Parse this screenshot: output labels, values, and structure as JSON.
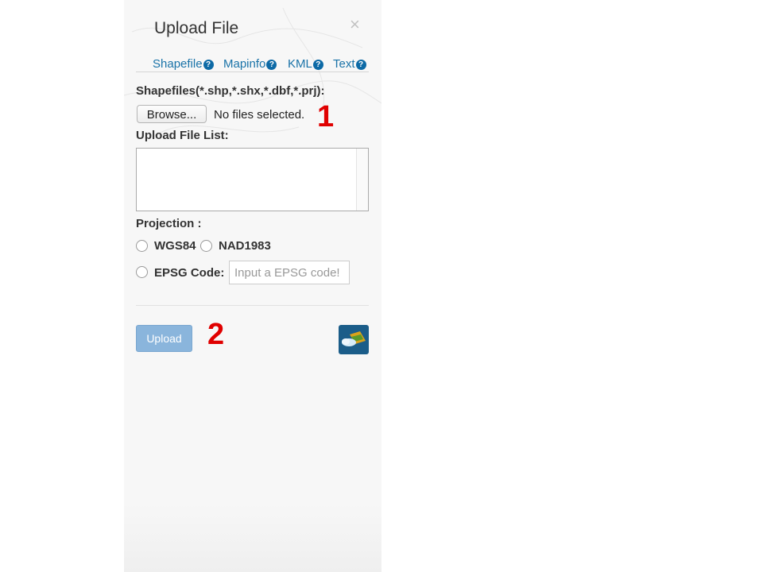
{
  "dialog": {
    "title": "Upload File",
    "close_symbol": "×"
  },
  "tabs": [
    {
      "label": "Shapefile",
      "icon": "help-icon"
    },
    {
      "label": "Mapinfo",
      "icon": "help-icon"
    },
    {
      "label": "KML",
      "icon": "help-icon"
    },
    {
      "label": "Text",
      "icon": "help-icon"
    }
  ],
  "help_glyph": "?",
  "shapefile": {
    "label": "Shapefiles(*.shp,*.shx,*.dbf,*.prj):",
    "browse_label": "Browse...",
    "file_status": "No files selected."
  },
  "file_list": {
    "label": "Upload File List:"
  },
  "projection": {
    "label": "Projection :",
    "options": [
      {
        "label": "WGS84",
        "selected": false
      },
      {
        "label": "NAD1983",
        "selected": false
      },
      {
        "label": "EPSG Code:",
        "selected": false
      }
    ],
    "epsg_placeholder": "Input a EPSG code!",
    "epsg_value": ""
  },
  "upload_label": "Upload",
  "annotations": [
    "1",
    "2"
  ],
  "colors": {
    "accent": "#1a73a8",
    "upload_button": "#8ab5dc",
    "annotation": "#e00000",
    "app_icon_bg": "#1b5d89"
  }
}
